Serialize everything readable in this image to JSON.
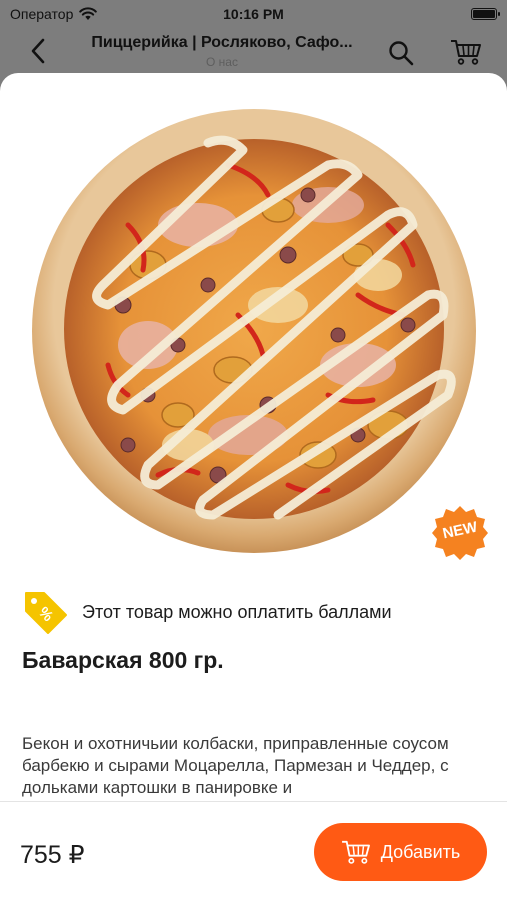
{
  "status_bar": {
    "carrier": "Оператор",
    "time": "10:16 PM"
  },
  "nav": {
    "title": "Пиццерийка | Росляково, Сафо...",
    "subtitle": "О нас",
    "icons": [
      "back-chevron-icon",
      "search-icon",
      "cart-icon"
    ]
  },
  "product": {
    "badge_new": "NEW",
    "points_text": "Этот товар можно оплатить баллами",
    "title": "Баварская 800 гр.",
    "description": "Бекон и охотничьии колбаски, приправленные соусом барбекю и сырами Моцарелла, Пармезан и Чеддер, с дольками картошки в панировке и"
  },
  "bottom_bar": {
    "price": "755 ₽",
    "add_button_label": "Добавить"
  },
  "colors": {
    "accent": "#ff5a14",
    "badge_yellow": "#f5c400",
    "new_badge": "#f58220"
  }
}
